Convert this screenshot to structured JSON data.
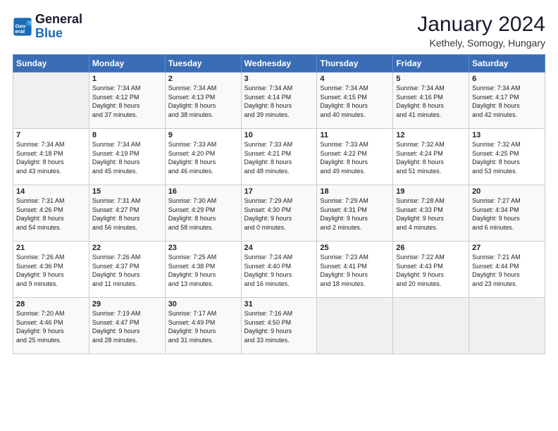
{
  "header": {
    "logo_line1": "General",
    "logo_line2": "Blue",
    "title": "January 2024",
    "subtitle": "Kethely, Somogy, Hungary"
  },
  "weekdays": [
    "Sunday",
    "Monday",
    "Tuesday",
    "Wednesday",
    "Thursday",
    "Friday",
    "Saturday"
  ],
  "weeks": [
    [
      {
        "num": "",
        "info": ""
      },
      {
        "num": "1",
        "info": "Sunrise: 7:34 AM\nSunset: 4:12 PM\nDaylight: 8 hours\nand 37 minutes."
      },
      {
        "num": "2",
        "info": "Sunrise: 7:34 AM\nSunset: 4:13 PM\nDaylight: 8 hours\nand 38 minutes."
      },
      {
        "num": "3",
        "info": "Sunrise: 7:34 AM\nSunset: 4:14 PM\nDaylight: 8 hours\nand 39 minutes."
      },
      {
        "num": "4",
        "info": "Sunrise: 7:34 AM\nSunset: 4:15 PM\nDaylight: 8 hours\nand 40 minutes."
      },
      {
        "num": "5",
        "info": "Sunrise: 7:34 AM\nSunset: 4:16 PM\nDaylight: 8 hours\nand 41 minutes."
      },
      {
        "num": "6",
        "info": "Sunrise: 7:34 AM\nSunset: 4:17 PM\nDaylight: 8 hours\nand 42 minutes."
      }
    ],
    [
      {
        "num": "7",
        "info": "Sunrise: 7:34 AM\nSunset: 4:18 PM\nDaylight: 8 hours\nand 43 minutes."
      },
      {
        "num": "8",
        "info": "Sunrise: 7:34 AM\nSunset: 4:19 PM\nDaylight: 8 hours\nand 45 minutes."
      },
      {
        "num": "9",
        "info": "Sunrise: 7:33 AM\nSunset: 4:20 PM\nDaylight: 8 hours\nand 46 minutes."
      },
      {
        "num": "10",
        "info": "Sunrise: 7:33 AM\nSunset: 4:21 PM\nDaylight: 8 hours\nand 48 minutes."
      },
      {
        "num": "11",
        "info": "Sunrise: 7:33 AM\nSunset: 4:22 PM\nDaylight: 8 hours\nand 49 minutes."
      },
      {
        "num": "12",
        "info": "Sunrise: 7:32 AM\nSunset: 4:24 PM\nDaylight: 8 hours\nand 51 minutes."
      },
      {
        "num": "13",
        "info": "Sunrise: 7:32 AM\nSunset: 4:25 PM\nDaylight: 8 hours\nand 53 minutes."
      }
    ],
    [
      {
        "num": "14",
        "info": "Sunrise: 7:31 AM\nSunset: 4:26 PM\nDaylight: 8 hours\nand 54 minutes."
      },
      {
        "num": "15",
        "info": "Sunrise: 7:31 AM\nSunset: 4:27 PM\nDaylight: 8 hours\nand 56 minutes."
      },
      {
        "num": "16",
        "info": "Sunrise: 7:30 AM\nSunset: 4:29 PM\nDaylight: 8 hours\nand 58 minutes."
      },
      {
        "num": "17",
        "info": "Sunrise: 7:29 AM\nSunset: 4:30 PM\nDaylight: 9 hours\nand 0 minutes."
      },
      {
        "num": "18",
        "info": "Sunrise: 7:29 AM\nSunset: 4:31 PM\nDaylight: 9 hours\nand 2 minutes."
      },
      {
        "num": "19",
        "info": "Sunrise: 7:28 AM\nSunset: 4:33 PM\nDaylight: 9 hours\nand 4 minutes."
      },
      {
        "num": "20",
        "info": "Sunrise: 7:27 AM\nSunset: 4:34 PM\nDaylight: 9 hours\nand 6 minutes."
      }
    ],
    [
      {
        "num": "21",
        "info": "Sunrise: 7:26 AM\nSunset: 4:36 PM\nDaylight: 9 hours\nand 9 minutes."
      },
      {
        "num": "22",
        "info": "Sunrise: 7:26 AM\nSunset: 4:37 PM\nDaylight: 9 hours\nand 11 minutes."
      },
      {
        "num": "23",
        "info": "Sunrise: 7:25 AM\nSunset: 4:38 PM\nDaylight: 9 hours\nand 13 minutes."
      },
      {
        "num": "24",
        "info": "Sunrise: 7:24 AM\nSunset: 4:40 PM\nDaylight: 9 hours\nand 16 minutes."
      },
      {
        "num": "25",
        "info": "Sunrise: 7:23 AM\nSunset: 4:41 PM\nDaylight: 9 hours\nand 18 minutes."
      },
      {
        "num": "26",
        "info": "Sunrise: 7:22 AM\nSunset: 4:43 PM\nDaylight: 9 hours\nand 20 minutes."
      },
      {
        "num": "27",
        "info": "Sunrise: 7:21 AM\nSunset: 4:44 PM\nDaylight: 9 hours\nand 23 minutes."
      }
    ],
    [
      {
        "num": "28",
        "info": "Sunrise: 7:20 AM\nSunset: 4:46 PM\nDaylight: 9 hours\nand 25 minutes."
      },
      {
        "num": "29",
        "info": "Sunrise: 7:19 AM\nSunset: 4:47 PM\nDaylight: 9 hours\nand 28 minutes."
      },
      {
        "num": "30",
        "info": "Sunrise: 7:17 AM\nSunset: 4:49 PM\nDaylight: 9 hours\nand 31 minutes."
      },
      {
        "num": "31",
        "info": "Sunrise: 7:16 AM\nSunset: 4:50 PM\nDaylight: 9 hours\nand 33 minutes."
      },
      {
        "num": "",
        "info": ""
      },
      {
        "num": "",
        "info": ""
      },
      {
        "num": "",
        "info": ""
      }
    ]
  ]
}
